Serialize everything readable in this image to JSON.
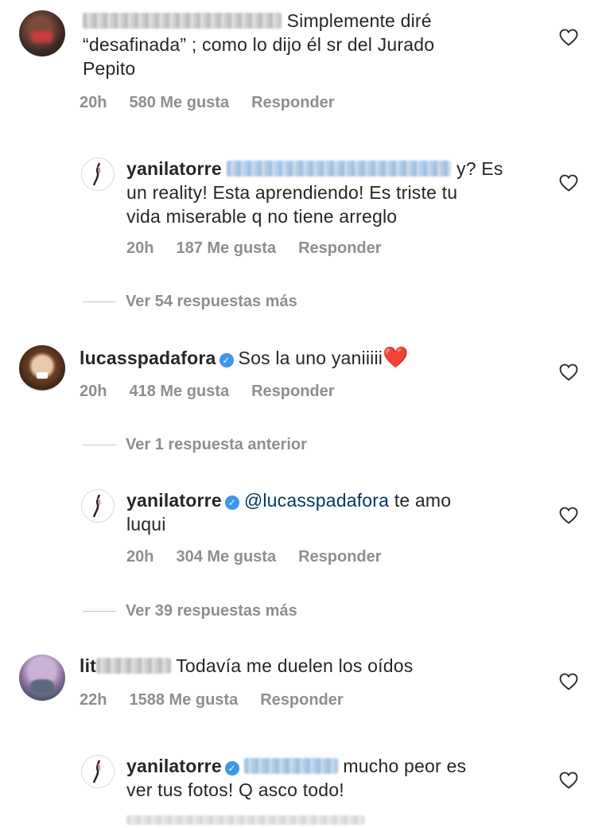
{
  "comments": [
    {
      "text_1": "Simplemente diré",
      "text_2": "“desafinada” ; como lo dijo él sr del Jurado",
      "text_3": "Pepito",
      "time": "20h",
      "likes": "580 Me gusta",
      "reply": "Responder"
    },
    {
      "username": "yanilatorre",
      "text_1": "y? Es",
      "text_2": "un reality! Esta aprendiendo! Es triste tu",
      "text_3": "vida miserable q no tiene arreglo",
      "time": "20h",
      "likes": "187 Me gusta",
      "reply": "Responder"
    },
    {
      "username": "lucasspadafora",
      "text_1": "Sos la uno yaniiiii",
      "emoji": "❤️",
      "time": "20h",
      "likes": "418 Me gusta",
      "reply": "Responder"
    },
    {
      "username": "yanilatorre",
      "mention": "@lucasspadafora",
      "text_1": "te amo",
      "text_2": "luqui",
      "time": "20h",
      "likes": "304 Me gusta",
      "reply": "Responder"
    },
    {
      "username_partial": "lit",
      "text_1": "Todavía me duelen los oídos",
      "time": "22h",
      "likes": "1588 Me gusta",
      "reply": "Responder"
    },
    {
      "username": "yanilatorre",
      "text_1": "mucho peor es",
      "text_2": "ver tus fotos! Q asco todo!"
    }
  ],
  "view_more": {
    "first": "Ver 54 respuestas más",
    "previous": "Ver 1 respuesta anterior",
    "second": "Ver 39 respuestas más"
  },
  "icons": {
    "heart": "heart-outline-icon",
    "verified": "verified-badge-icon"
  },
  "colors": {
    "text": "#262626",
    "meta": "#8e8e8e",
    "mention": "#00376b",
    "verified": "#3897f0",
    "heart_emoji": "#e0243a"
  }
}
